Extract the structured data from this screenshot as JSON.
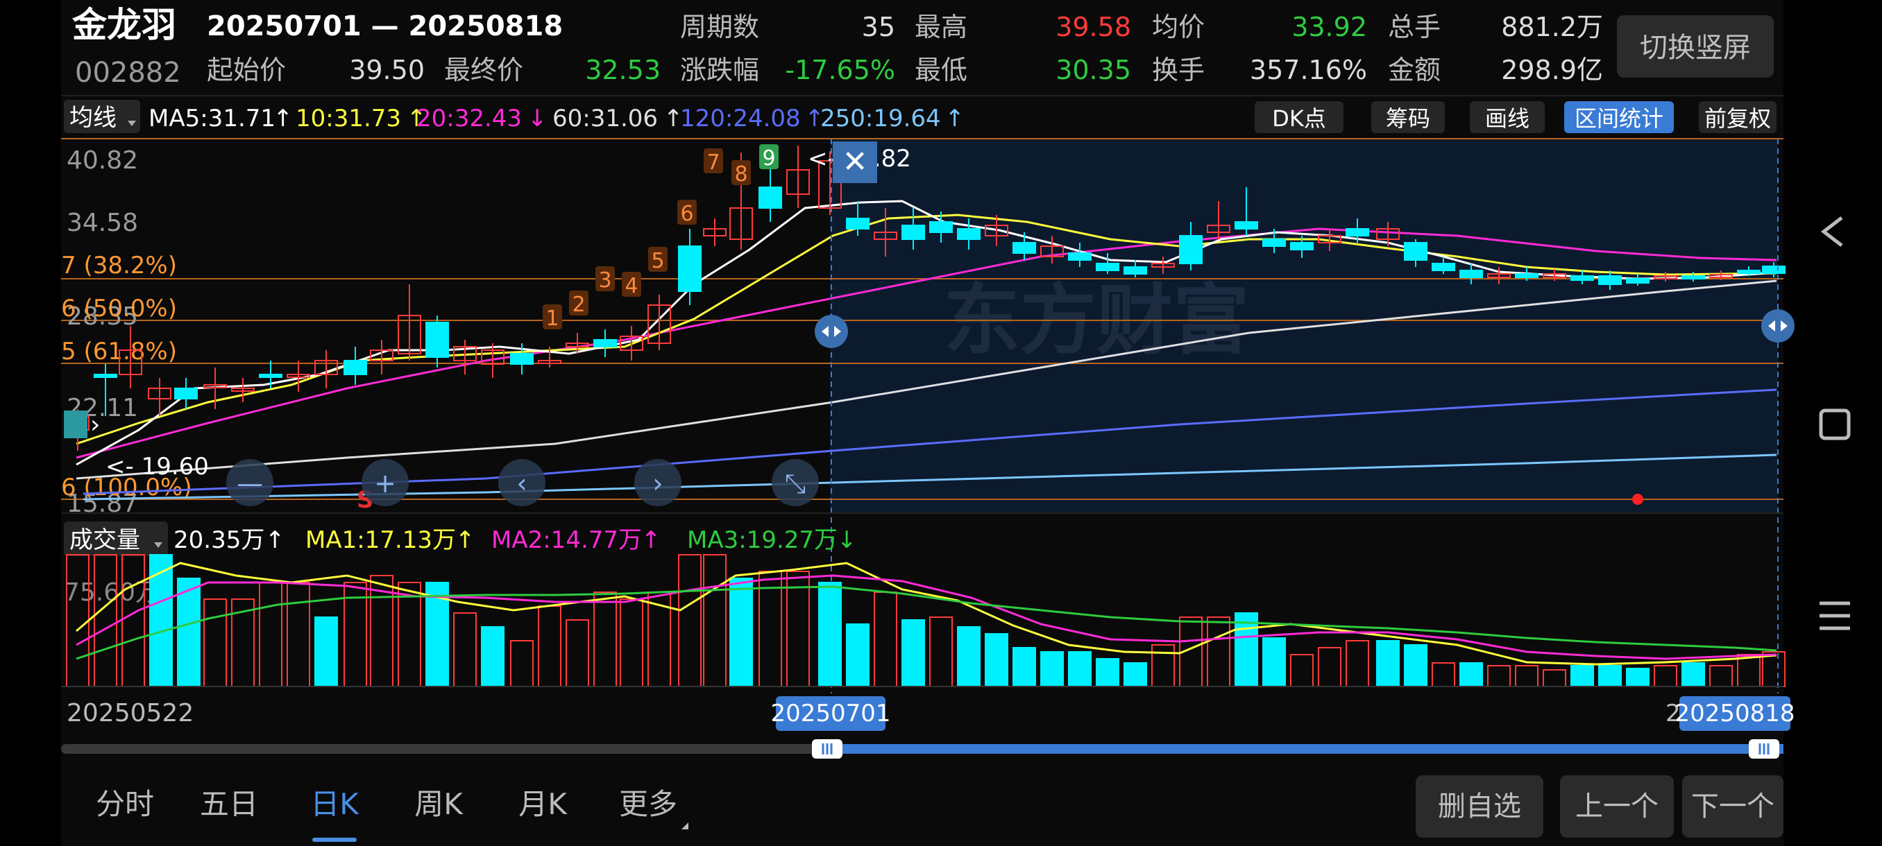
{
  "header": {
    "stock_name": "金龙羽",
    "stock_code": "002882",
    "date_range": "20250701 — 20250818",
    "stats": [
      {
        "label": "周期数",
        "value": "35",
        "color": "#dddddd"
      },
      {
        "label": "最高",
        "value": "39.58",
        "color": "#ff3b3b"
      },
      {
        "label": "均价",
        "value": "33.92",
        "color": "#2ecc40"
      },
      {
        "label": "总手",
        "value": "881.2万",
        "color": "#dddddd"
      },
      {
        "label": "起始价",
        "value": "39.50",
        "color": "#dddddd"
      },
      {
        "label": "最终价",
        "value": "32.53",
        "color": "#2ecc40"
      },
      {
        "label": "涨跌幅",
        "value": "-17.65%",
        "color": "#2ecc40"
      },
      {
        "label": "最低",
        "value": "30.35",
        "color": "#2ecc40"
      },
      {
        "label": "换手",
        "value": "357.16%",
        "color": "#dddddd"
      },
      {
        "label": "金额",
        "value": "298.9亿",
        "color": "#dddddd"
      }
    ],
    "switch_button": "切换竖屏"
  },
  "ma_bar": {
    "dropdown": "均线",
    "items": [
      {
        "text": "MA5:31.71",
        "arrow": "↑",
        "color": "#ffffff"
      },
      {
        "text": "10:31.73",
        "arrow": "↑",
        "color": "#ffff3c"
      },
      {
        "text": "20:32.43",
        "arrow": "↓",
        "color": "#ff2bd6"
      },
      {
        "text": "60:31.06",
        "arrow": "↑",
        "color": "#e0e0e0"
      },
      {
        "text": "120:24.08",
        "arrow": "↑",
        "color": "#5b6cff"
      },
      {
        "text": "250:19.64",
        "arrow": "↑",
        "color": "#7cc7ff"
      }
    ],
    "right_buttons": [
      {
        "label": "DK点",
        "active": false
      },
      {
        "label": "筹码",
        "active": false
      },
      {
        "label": "画线",
        "active": false
      },
      {
        "label": "区间统计",
        "active": true
      },
      {
        "label": "前复权",
        "active": false
      }
    ]
  },
  "price_chart": {
    "y_labels": [
      "40.82",
      "34.58",
      "28.35",
      "22.11",
      "15.87"
    ],
    "fib_labels": [
      "7 (38.2%)",
      "6 (50.0%)",
      "5 (61.8%)",
      "6 (100.0%)"
    ],
    "high_marker": "40.82",
    "low_marker": "19.60",
    "td_counts": [
      "1",
      "2",
      "3",
      "4",
      "5",
      "6",
      "7",
      "8",
      "9"
    ],
    "sell_marker": "S",
    "watermark": "东方财富"
  },
  "volume_bar": {
    "dropdown": "成交量",
    "items": [
      {
        "text": "20.35万",
        "arrow": "↑",
        "color": "#ffffff"
      },
      {
        "text": "MA1:17.13万",
        "arrow": "↑",
        "color": "#ffff3c"
      },
      {
        "text": "MA2:14.77万",
        "arrow": "↑",
        "color": "#ff2bd6"
      },
      {
        "text": "MA3:19.27万",
        "arrow": "↓",
        "color": "#2ecc40"
      }
    ],
    "y_label": "75.60万"
  },
  "date_axis": {
    "start": "20250522",
    "range_start": "20250701",
    "range_end": "20250818",
    "partial": "2"
  },
  "tabs": [
    {
      "label": "分时",
      "active": false
    },
    {
      "label": "五日",
      "active": false
    },
    {
      "label": "日K",
      "active": true
    },
    {
      "label": "周K",
      "active": false
    },
    {
      "label": "月K",
      "active": false
    },
    {
      "label": "更多",
      "active": false
    }
  ],
  "bottom_buttons": [
    "删自选",
    "上一个",
    "下一个"
  ],
  "colors": {
    "up": "#ff3b3b",
    "down": "#00f0ff",
    "accent": "#3a7bd5",
    "fib": "#ff9933"
  }
}
